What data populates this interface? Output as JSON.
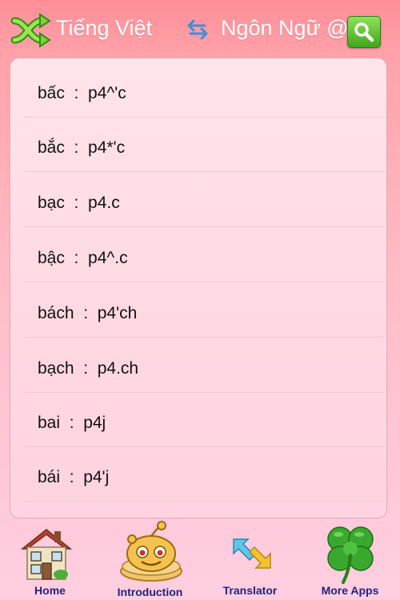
{
  "header": {
    "source_language": "Tiếng Việt",
    "target_language": "Ngôn Ngữ @",
    "shuffle_icon": "shuffle-icon",
    "swap_icon": "swap-arrows-icon",
    "search_icon": "search-icon"
  },
  "entries": [
    {
      "label": "bấc  :  p4^'c"
    },
    {
      "label": "bắc  :  p4*'c"
    },
    {
      "label": "bạc  :  p4.c"
    },
    {
      "label": "bậc  :  p4^.c"
    },
    {
      "label": "bách  :  p4'ch"
    },
    {
      "label": "bạch  :  p4.ch"
    },
    {
      "label": "bai  :  p4j"
    },
    {
      "label": "bái  :  p4'j"
    }
  ],
  "tabbar": {
    "home": "Home",
    "introduction": "Introduction",
    "translator": "Translator",
    "more_apps": "More Apps"
  }
}
